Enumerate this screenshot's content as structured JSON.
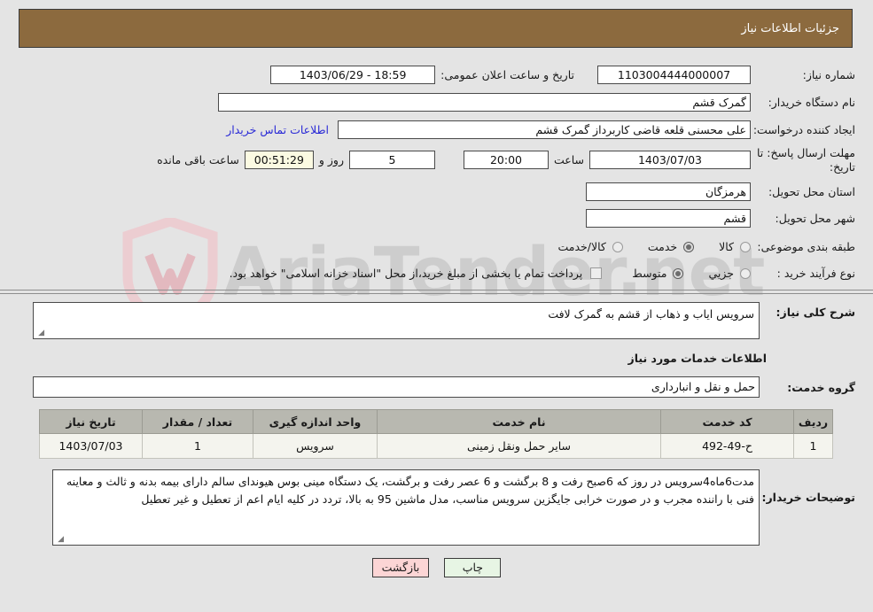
{
  "header": {
    "title": "جزئیات اطلاعات نیاز",
    "bar_color": "#8c6a3e"
  },
  "watermark": {
    "text": "AriaTender.net",
    "shield_color": "#e9c9cd"
  },
  "form": {
    "need_number_label": "شماره نیاز:",
    "need_number_value": "1103004444000007",
    "public_announce_label": "تاریخ و ساعت اعلان عمومی:",
    "public_announce_value": "18:59 - 1403/06/29",
    "buyer_org_label": "نام دستگاه خریدار:",
    "buyer_org_value": "گمرک قشم",
    "requester_label": "ایجاد کننده درخواست:",
    "requester_value": "علی  محسنی قلعه قاضی کاربرداز گمرک قشم",
    "contact_link": "اطلاعات تماس خریدار",
    "deadline_label": "مهلت ارسال پاسخ: تا تاریخ:",
    "deadline_date": "1403/07/03",
    "deadline_hour_label": "ساعت",
    "deadline_hour_value": "20:00",
    "remaining_days": "5",
    "remaining_days_label": "روز و",
    "remaining_timer": "00:51:29",
    "remaining_timer_label": "ساعت باقی مانده",
    "province_label": "استان محل تحویل:",
    "province_value": "هرمزگان",
    "city_label": "شهر محل تحویل:",
    "city_value": "قشم",
    "category_label": "طبقه بندی موضوعی:",
    "category_options": [
      {
        "label": "کالا",
        "selected": false
      },
      {
        "label": "خدمت",
        "selected": true
      },
      {
        "label": "کالا/خدمت",
        "selected": false
      }
    ],
    "process_label": "نوع فرآیند خرید :",
    "process_options": [
      {
        "label": "جزیي",
        "selected": false
      },
      {
        "label": "متوسط",
        "selected": true
      }
    ],
    "treasury_checkbox_checked": false,
    "treasury_note": "پرداخت تمام یا بخشی از مبلغ خرید،از محل \"اسناد خزانه اسلامی\" خواهد بود."
  },
  "description": {
    "label": "شرح کلی نیاز:",
    "value": "سرویس ایاب و ذهاب از قشم به گمرک لافت"
  },
  "services_section": {
    "heading": "اطلاعات خدمات مورد نیاز",
    "group_label": "گروه خدمت:",
    "group_value": "حمل و نقل و انبارداری"
  },
  "table": {
    "columns": [
      "ردیف",
      "کد خدمت",
      "نام خدمت",
      "واحد اندازه گیری",
      "تعداد / مقدار",
      "تاریخ نیاز"
    ],
    "rows": [
      {
        "index": "1",
        "service_code": "ح-49-492",
        "service_name": "سایر حمل ونقل زمینی",
        "unit": "سرویس",
        "quantity": "1",
        "need_date": "1403/07/03"
      }
    ]
  },
  "buyer_notes": {
    "label": "توضیحات خریدار:",
    "value": "مدت6ماه4سرویس در روز که 6صبح رفت و 8 برگشت و 6 عصر رفت و برگشت، یک دستگاه مینی بوس هیوندای سالم دارای بیمه بدنه و ثالث و معاینه فنی با راننده مجرب و در صورت خرابی جایگزین سرویس مناسب، مدل ماشین 95 به بالا، تردد در کلیه ایام اعم از تعطیل و غیر تعطیل"
  },
  "buttons": {
    "print": "چاپ",
    "back": "بازگشت"
  }
}
